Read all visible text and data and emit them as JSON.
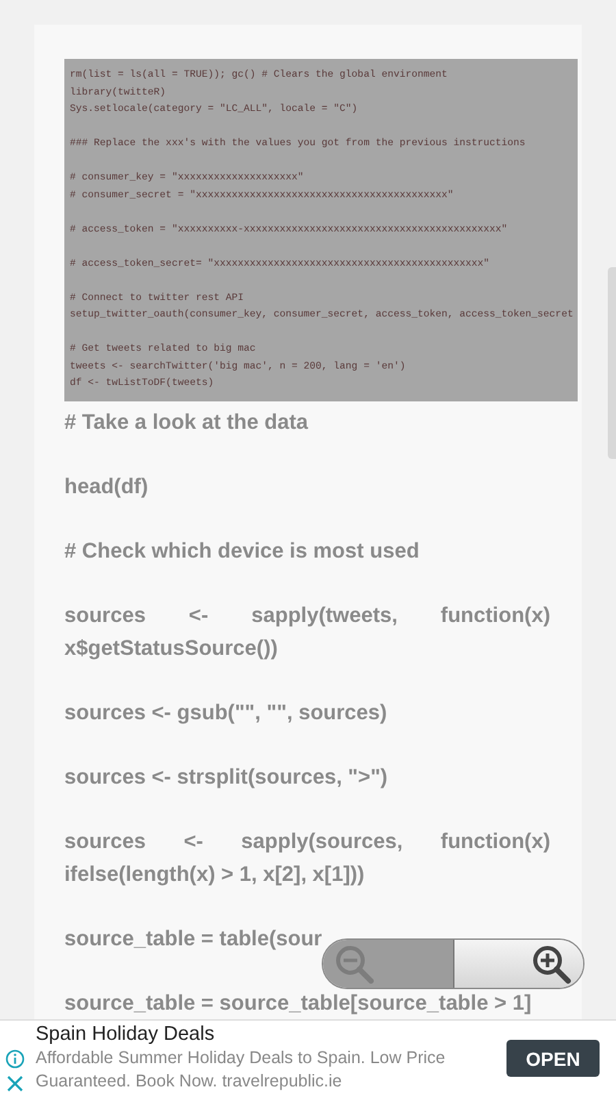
{
  "code_image": {
    "blocks": [
      [
        "rm(list = ls(all = TRUE)); gc() # Clears the global environment",
        "library(twitteR)",
        "Sys.setlocale(category = \"LC_ALL\", locale = \"C\")"
      ],
      [
        "### Replace the xxx's with the values you got from the previous instructions"
      ],
      [
        "# consumer_key = \"xxxxxxxxxxxxxxxxxxxx\"",
        "# consumer_secret = \"xxxxxxxxxxxxxxxxxxxxxxxxxxxxxxxxxxxxxxxxxx\""
      ],
      [
        "# access_token = \"xxxxxxxxxx-xxxxxxxxxxxxxxxxxxxxxxxxxxxxxxxxxxxxxxxxxxx\""
      ],
      [
        "# access_token_secret= \"xxxxxxxxxxxxxxxxxxxxxxxxxxxxxxxxxxxxxxxxxxxxx\""
      ],
      [
        "# Connect to twitter rest API",
        "setup_twitter_oauth(consumer_key, consumer_secret, access_token, access_token_secret"
      ],
      [
        "# Get tweets related to big mac",
        "tweets <- searchTwitter('big mac', n = 200, lang = 'en')",
        "df <- twListToDF(tweets)"
      ]
    ]
  },
  "paragraphs": [
    "# Take a look at the data",
    "head(df)",
    "# Check which device is most used",
    "sources <- sapply(tweets, function(x) x$getStatusSource())",
    "sources <- gsub(\"\", \"\", sources)",
    "sources <- strsplit(sources, \">\")",
    "sources <- sapply(sources, function(x) ifelse(length(x) > 1, x[2], x[1]))",
    "source_table = table(sour",
    "source_table = source_table[source_table > 1]"
  ],
  "zoom_control": {
    "zoom_out_disabled": true
  },
  "ad": {
    "title": "Spain Holiday Deals",
    "body": "Affordable Summer Holiday Deals to Spain. Low Price Guaranteed. Book Now. travelrepublic.ie",
    "button": "OPEN"
  }
}
